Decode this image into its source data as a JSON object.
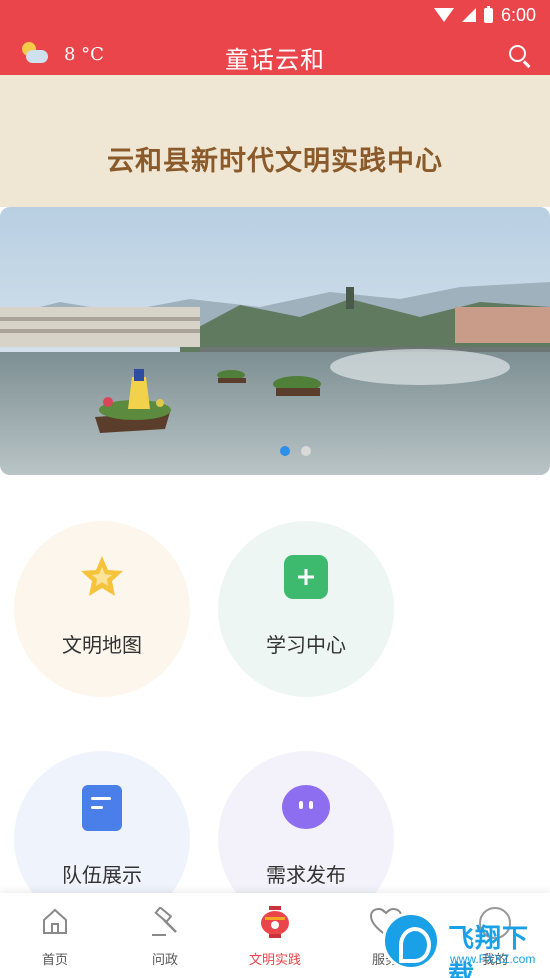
{
  "status_bar": {
    "time": "6:00"
  },
  "header": {
    "temperature": "8 °C",
    "weather_icon": "partly-cloudy-icon",
    "title": "童话云和",
    "search_icon": "search-icon"
  },
  "banner": {
    "title": "云和县新时代文明实践中心"
  },
  "carousel": {
    "slide_count": 2,
    "active_index": 0
  },
  "features": [
    {
      "label": "文明地图",
      "icon": "star-icon"
    },
    {
      "label": "学习中心",
      "icon": "plus-icon"
    },
    {
      "label": "队伍展示",
      "icon": "bookmark-icon"
    },
    {
      "label": "需求发布",
      "icon": "chat-icon"
    }
  ],
  "tabs": [
    {
      "label": "首页",
      "icon": "home-icon"
    },
    {
      "label": "问政",
      "icon": "gavel-icon"
    },
    {
      "label": "文明实践",
      "icon": "lantern-icon",
      "active": true
    },
    {
      "label": "服务",
      "icon": "heart-icon"
    },
    {
      "label": "我的",
      "icon": "profile-icon"
    }
  ],
  "colors": {
    "primary": "#e9454a",
    "banner_text": "#8a5a2b",
    "dot_active": "#2f8ee8"
  },
  "watermark": {
    "text": "飞翔下载",
    "url": "www.FXXZ.com"
  }
}
